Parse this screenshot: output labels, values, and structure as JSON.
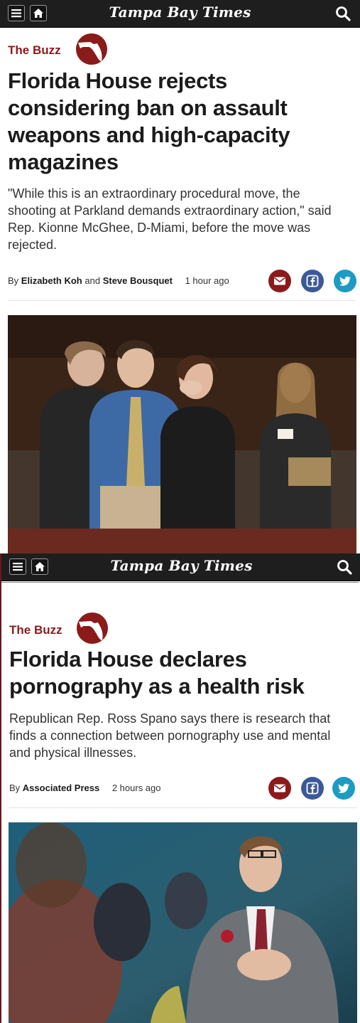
{
  "masthead": "Tampa Bay Times",
  "header_icons": {
    "menu": "menu-icon",
    "home": "home-icon",
    "search": "search-icon"
  },
  "colors": {
    "header_bg": "#1e1e1e",
    "kicker": "#8b1a1a",
    "mail": "#8b1a1a",
    "facebook": "#3b5998",
    "twitter": "#1d9bc2"
  },
  "articles": [
    {
      "kicker": "The Buzz",
      "headline": "Florida House rejects considering ban on assault weapons and high-capacity magazines",
      "dek": "\"While this is an extraordinary procedural move, the shooting at Parkland demands extraordinary action,\" said Rep. Kionne McGhee, D-Miami, before the move was rejected.",
      "byline_prefix": "By",
      "author1": "Elizabeth Koh",
      "and": "and",
      "author2": "Steve Bousquet",
      "time": "1 hour ago",
      "share_icons": [
        "mail-icon",
        "facebook-icon",
        "twitter-icon"
      ]
    },
    {
      "kicker": "The Buzz",
      "headline": "Florida House declares pornography as a health risk",
      "dek": "Republican Rep. Ross Spano says there is research that finds a connection between pornography use and mental and physical illnesses.",
      "byline_prefix": "By",
      "author1": "Associated Press",
      "time": "2 hours ago",
      "share_icons": [
        "mail-icon",
        "facebook-icon",
        "twitter-icon"
      ]
    }
  ]
}
